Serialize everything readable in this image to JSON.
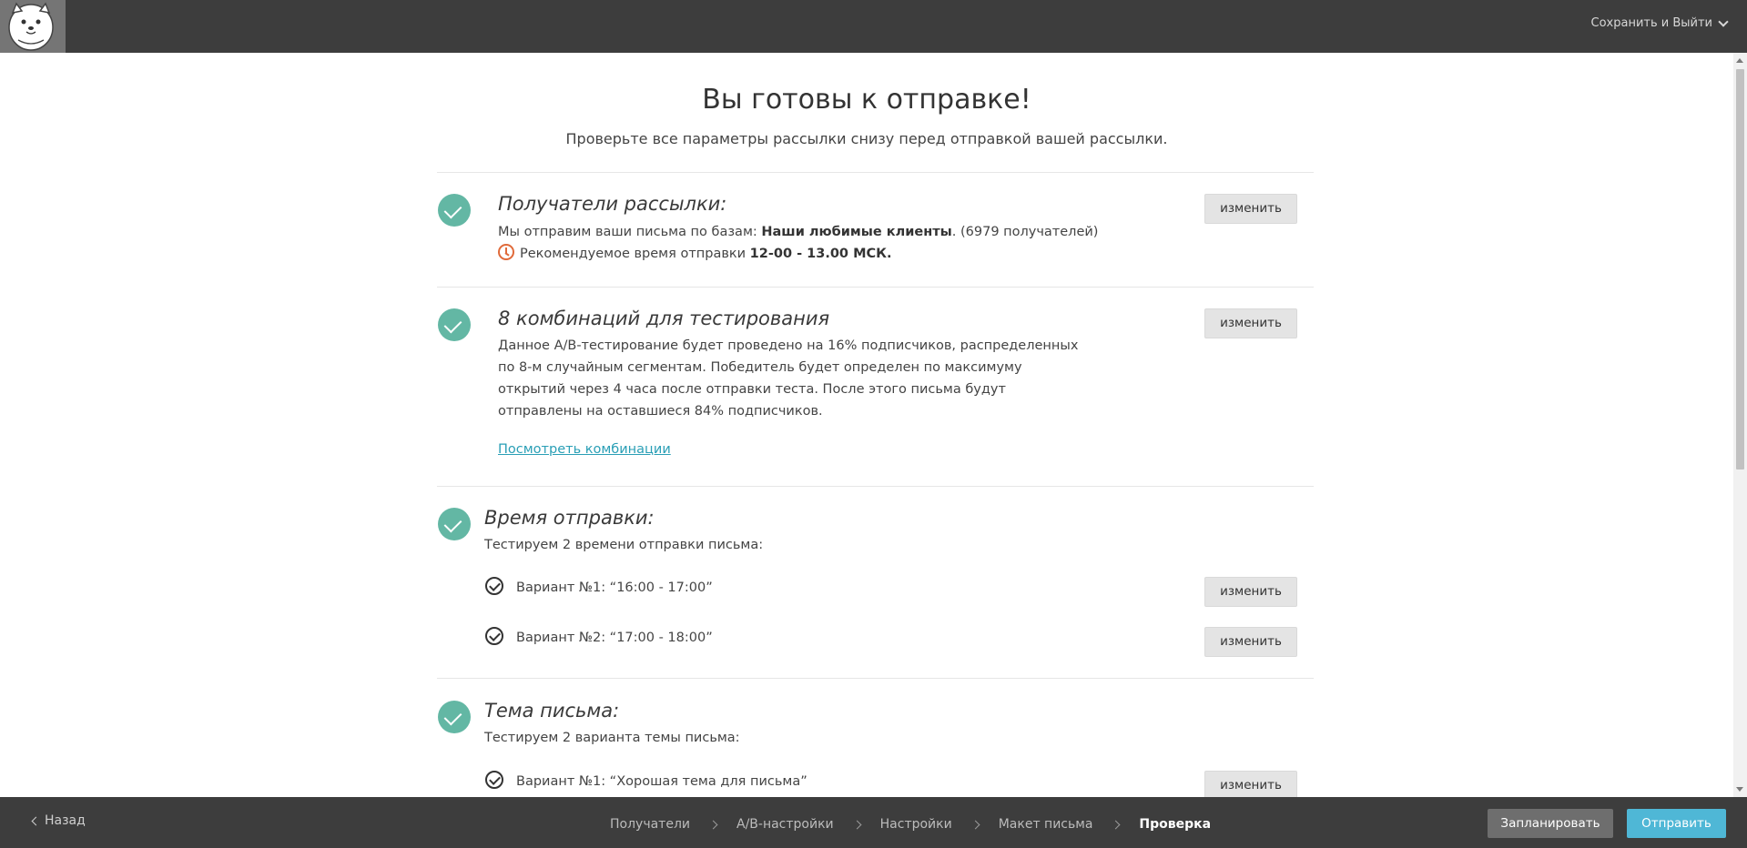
{
  "header": {
    "save_exit_label": "Сохранить и Выйти"
  },
  "page": {
    "title": "Вы готовы к отправке!",
    "subtitle": "Проверьте все параметры рассылки снизу перед отправкой вашей рассылки."
  },
  "sections": {
    "recipients": {
      "title": "Получатели рассылки:",
      "line1_prefix": "Мы отправим ваши письма по базам: ",
      "line1_bold": "Наши любимые клиенты",
      "line1_suffix": ". (6979 получателей)",
      "line2_prefix": "Рекомендуемое время отправки ",
      "line2_bold": "12-00 - 13.00 МСК.",
      "change_label": "изменить"
    },
    "combinations": {
      "title": "8 комбинаций для тестирования",
      "description": "Данное А/В-тестирование будет проведено на 16% подписчиков, распределенных по 8-м случайным сегментам. Победитель будет определен по максимуму открытий через 4 часа после отправки теста. После этого письма будут отправлены на оставшиеся 84% подписчиков.",
      "link_label": "Посмотреть комбинации",
      "change_label": "изменить"
    },
    "send_time": {
      "title": "Время отправки:",
      "subtitle": "Тестируем 2 времени отправки письма:",
      "variants": [
        {
          "label": "Вариант №1: “16:00 - 17:00”",
          "change_label": "изменить"
        },
        {
          "label": "Вариант №2: “17:00 - 18:00”",
          "change_label": "изменить"
        }
      ]
    },
    "subject": {
      "title": "Тема письма:",
      "subtitle": "Тестируем 2 варианта темы письма:",
      "variants": [
        {
          "label": "Вариант №1: “Хорошая тема для письма”",
          "change_label": "изменить"
        }
      ]
    }
  },
  "footer": {
    "back_label": "Назад",
    "steps": [
      "Получатели",
      "A/B-настройки",
      "Настройки",
      "Макет письма",
      "Проверка"
    ],
    "active_step": "Проверка",
    "schedule_label": "Запланировать",
    "send_label": "Отправить"
  },
  "colors": {
    "topbar": "#3d3d3d",
    "check_green": "#63b7a4",
    "clock_orange": "#e06a3a",
    "link_blue": "#2a9fb6",
    "send_button": "#4fb7d6",
    "schedule_button": "#6e6e6e"
  }
}
